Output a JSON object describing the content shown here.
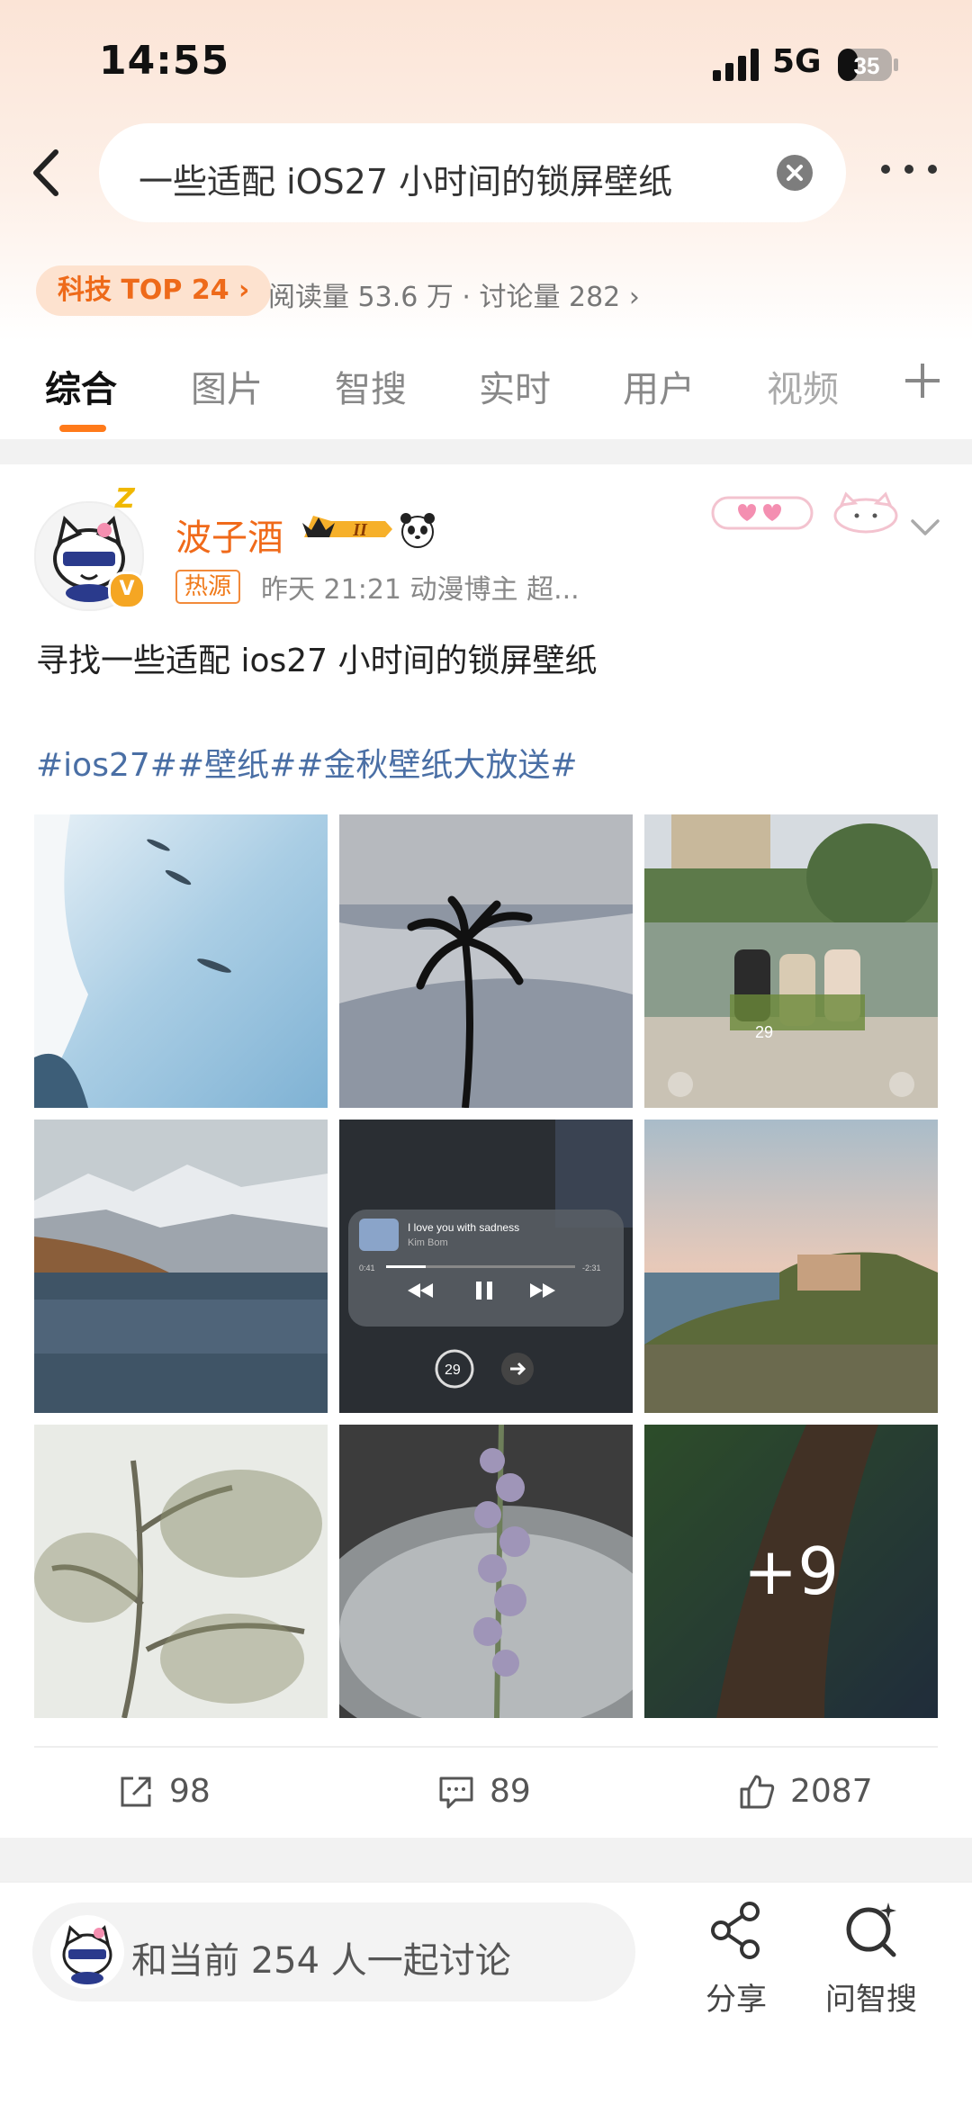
{
  "status_bar": {
    "time": "14:55",
    "network": "5G",
    "battery": "35"
  },
  "search": {
    "query": "一些适配 iOS27 小时间的锁屏壁纸"
  },
  "topic": {
    "tag": "科技 TOP 24",
    "stats": "阅读量 53.6 万 · 讨论量 282"
  },
  "tabs": [
    {
      "label": "综合",
      "active": true
    },
    {
      "label": "图片"
    },
    {
      "label": "智搜"
    },
    {
      "label": "实时"
    },
    {
      "label": "用户"
    },
    {
      "label": "视频"
    }
  ],
  "post": {
    "username": "波子酒",
    "level_badge": "II",
    "hot_source_label": "热源",
    "meta": "昨天 21:21  动漫博主 超...",
    "verified_mark": "V",
    "text": "寻找一些适配 ios27 小时间的锁屏壁纸",
    "hashtags": "#ios27##壁纸##金秋壁纸大放送#",
    "more_images": "+9",
    "music_widget": {
      "song": "I love you with sadness",
      "artist": "Kim Bom",
      "elapsed": "0:41",
      "remaining": "-2:31",
      "clock_hint": "29"
    },
    "image_clock_hint": "29",
    "shares": "98",
    "comments": "89",
    "likes": "2087"
  },
  "bottom_bar": {
    "discuss_text": "和当前 254 人一起讨论",
    "share_label": "分享",
    "ask_label": "问智搜"
  }
}
